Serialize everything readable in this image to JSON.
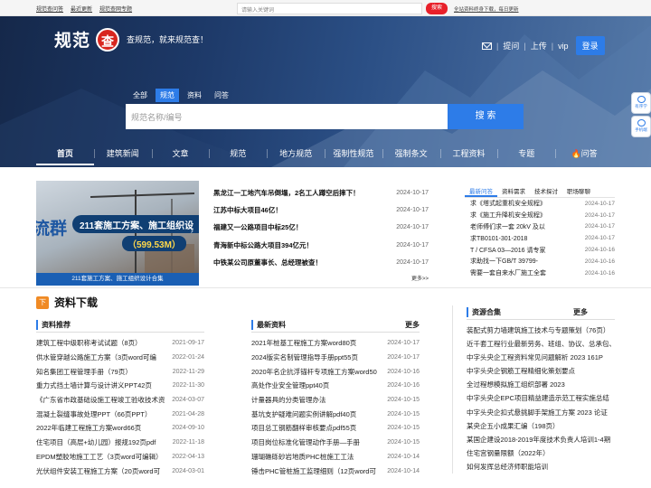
{
  "topbar": {
    "links": [
      "规范查问答",
      "最近更新",
      "规范查网专题"
    ],
    "search_placeholder": "请输入关键词",
    "search_button": "搜索",
    "promo": "全站资料终身下载，每日更新"
  },
  "brand": {
    "logo_text": "规范",
    "seal": "查",
    "slogan": "查规范，就来规范查！"
  },
  "user": {
    "ask": "提问",
    "upload": "上传",
    "vip": "vip",
    "login": "登录"
  },
  "search": {
    "tabs": [
      "全部",
      "规范",
      "资料",
      "问答"
    ],
    "active": 1,
    "placeholder": "规范名称/编号",
    "button": "搜 索"
  },
  "nav": [
    "首页",
    "建筑新闻",
    "文章",
    "规范",
    "地方规范",
    "强制性规范",
    "强制条文",
    "工程资料",
    "专题",
    "问答"
  ],
  "side": [
    "有序学",
    "手机端"
  ],
  "banner": {
    "big_text": "流群",
    "title": "211套施工方案、施工组织设",
    "size": "（599.53M）",
    "caption": "211套施工方案、施工组织设计合集"
  },
  "news": [
    {
      "title": "黑龙江一工地汽车吊倒塌，2名工人蹲空后摔下！",
      "date": "2024-10-17"
    },
    {
      "title": "江苏中标大项目46亿！",
      "date": "2024-10-17"
    },
    {
      "title": "福建又一公路项目中标25亿！",
      "date": "2024-10-17"
    },
    {
      "title": "青海新中标公路大项目394亿元！",
      "date": "2024-10-17"
    },
    {
      "title": "中铁某公司原董事长、总经理被查！",
      "date": "2024-10-17"
    }
  ],
  "news_more": "更多>>",
  "qa": {
    "tabs": [
      "最新问答",
      "资料需求",
      "技术探讨",
      "职场聊聊"
    ],
    "rows": [
      {
        "title": "求《塔式起重机安全规程》",
        "date": "2024-10-17"
      },
      {
        "title": "求《施工升降机安全规程》",
        "date": "2024-10-17"
      },
      {
        "title": "老师傅们求一套 20kV 及以",
        "date": "2024-10-17"
      },
      {
        "title": "求TB0101-301-2018",
        "date": "2024-10-17"
      },
      {
        "title": "T / CFSA 03—2016 请专家",
        "date": "2024-10-16"
      },
      {
        "title": "求助找一下GB/T 39799-",
        "date": "2024-10-16"
      },
      {
        "title": "需要一套自来水厂施工全套",
        "date": "2024-10-16"
      }
    ]
  },
  "section_title": "资料下载",
  "col1": {
    "title": "资料推荐",
    "rows": [
      {
        "title": "建筑工程中级职称考试试题（8页）",
        "date": "2021-09-17"
      },
      {
        "title": "供水管穿越公路施工方案（3页word可编",
        "date": "2022-01-24"
      },
      {
        "title": "知名集团工程管理手册（79页）",
        "date": "2022-11-29"
      },
      {
        "title": "重力式挡土墙计算与设计讲义PPT42页",
        "date": "2022-11-30"
      },
      {
        "title": "《广东省市政基础设施工程竣工验收技术资",
        "date": "2024-03-07"
      },
      {
        "title": "混凝土裂缝事故处理PPT（66页PPT）",
        "date": "2021-04-28"
      },
      {
        "title": "2022年临建工程施工方案word66页",
        "date": "2024-09-10"
      },
      {
        "title": "住宅项目（高层+幼儿园）报规192页pdf",
        "date": "2022-11-18"
      },
      {
        "title": "EPDM塑胶地施工工艺（3页word可编辑）",
        "date": "2022-04-13"
      },
      {
        "title": "光伏组件安装工程施工方案（20页word可",
        "date": "2024-03-01"
      }
    ]
  },
  "col2": {
    "title": "最新资料",
    "more": "更多",
    "rows": [
      {
        "title": "2021年桩基工程施工方案word80页",
        "date": "2024-10-17"
      },
      {
        "title": "2024版实名制管理指导手册ppt55页",
        "date": "2024-10-17"
      },
      {
        "title": "2020年名企抗浮锚杆专项施工方案word50",
        "date": "2024-10-16"
      },
      {
        "title": "高处作业安全管理ppt40页",
        "date": "2024-10-16"
      },
      {
        "title": "计量器具的分类管理办法",
        "date": "2024-10-15"
      },
      {
        "title": "基坑支护疑难问题实例讲解pdf40页",
        "date": "2024-10-15"
      },
      {
        "title": "项目总工钢筋翻样审核要点pdf55页",
        "date": "2024-10-15"
      },
      {
        "title": "项目岗位标准化管理动作手册—手册",
        "date": "2024-10-15"
      },
      {
        "title": "珊瑚礁砾砂岩地质PHC桩施工工法",
        "date": "2024-10-14"
      },
      {
        "title": "锤击PHC管桩施工监理细则（12页word可",
        "date": "2024-10-14"
      }
    ]
  },
  "col3": {
    "title": "资源合集",
    "more": "更多",
    "rows": [
      "装配式剪力墙建筑施工技术与专题策划（76页）",
      "近千套工程行业最新劳务、班组、协议、总承包、",
      "中字头央企工程资料常见问题解析 2023 161P",
      "中字头央企钢筋工程精细化策划要点",
      "全过程想模拟施工组织部署 2023",
      "中字头央企EPC项目精益建造示范工程实施总结",
      "中字头央企扣式悬挑脚手架施工方案 2023 论证",
      "某央企五小成果汇编（198页）",
      "某国企建设2018-2019年度技术负责人培训1-4期",
      "住宅宫钢量限额（2022年）",
      "如何发挥总经济师职能培训"
    ]
  },
  "colors": {
    "accent": "#2d7ce8",
    "brand_red": "#e8202a",
    "section_icon": "#f08a24"
  }
}
